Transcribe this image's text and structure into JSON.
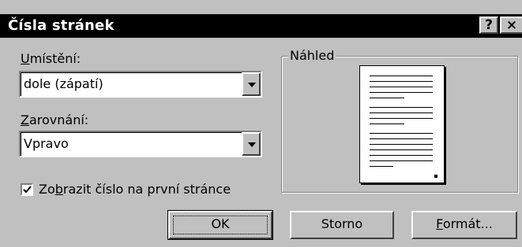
{
  "window": {
    "title": "Čísla stránek",
    "help_glyph": "?",
    "close_glyph": "×"
  },
  "position": {
    "label_prefix": "U",
    "label_rest": "místění:",
    "value": "dole (zápatí)"
  },
  "alignment": {
    "label_prefix": "Z",
    "label_rest": "arovnání:",
    "value": "Vpravo"
  },
  "first_page_checkbox": {
    "label_pre": "Zo",
    "label_accel": "b",
    "label_post": "razit číslo na první stránce",
    "checked": true
  },
  "preview": {
    "label": "Náhled"
  },
  "buttons": {
    "ok": "OK",
    "cancel": "Storno",
    "format_prefix": "F",
    "format_rest": "ormát..."
  },
  "colors": {
    "dialog_bg": "#c0c0c0",
    "titlebar_bg": "#000000",
    "titlebar_text": "#ffffff"
  }
}
